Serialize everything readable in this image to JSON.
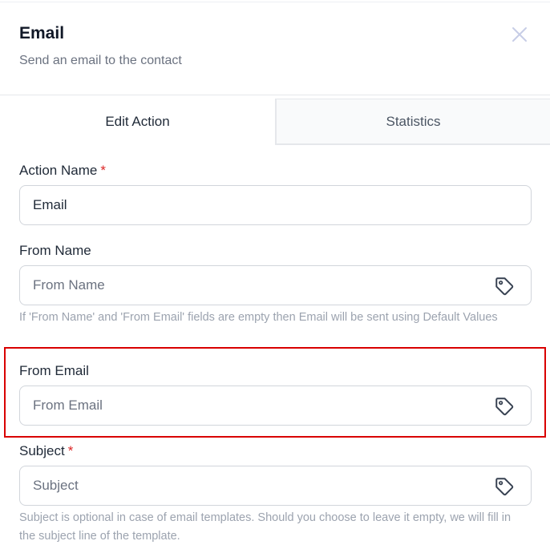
{
  "header": {
    "title": "Email",
    "subtitle": "Send an email to the contact"
  },
  "tabs": [
    {
      "label": "Edit Action",
      "active": true
    },
    {
      "label": "Statistics",
      "active": false
    }
  ],
  "fields": {
    "action_name": {
      "label": "Action Name",
      "required_mark": "*",
      "value": "Email"
    },
    "from_name": {
      "label": "From Name",
      "placeholder": "From Name",
      "help": "If 'From Name' and 'From Email' fields are empty then Email will be sent using Default Values"
    },
    "from_email": {
      "label": "From Email",
      "placeholder": "From Email"
    },
    "subject": {
      "label": "Subject",
      "required_mark": "*",
      "placeholder": "Subject",
      "help": "Subject is optional in case of email templates. Should you choose to leave it empty, we will fill in the subject line of the template."
    }
  },
  "colors": {
    "required": "#dc2626",
    "highlight": "#d90000",
    "icon": "#374151",
    "close": "#c7cde6"
  },
  "icons": {
    "close": "close-icon",
    "custom_values": "tag-icon"
  }
}
